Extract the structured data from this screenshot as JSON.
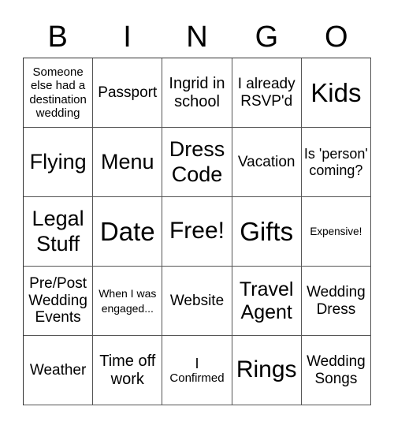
{
  "header": {
    "letters": [
      "B",
      "I",
      "N",
      "G",
      "O"
    ]
  },
  "board": {
    "rows": [
      [
        "Someone else had a destination wedding",
        "Passport",
        "Ingrid in school",
        "I already RSVP'd",
        "Kids"
      ],
      [
        "Flying",
        "Menu",
        "Dress Code",
        "Vacation",
        "Is 'person' coming?"
      ],
      [
        "Legal Stuff",
        "Date",
        "Free!",
        "Gifts",
        "Expensive!"
      ],
      [
        "Pre/Post Wedding Events",
        "When I was engaged...",
        "Website",
        "Travel Agent",
        "Wedding Dress"
      ],
      [
        "Weather",
        "Time off work",
        "I Confirmed",
        "Rings",
        "Wedding Songs"
      ]
    ],
    "confirmed_parts": [
      "I",
      "Confirmed"
    ]
  }
}
